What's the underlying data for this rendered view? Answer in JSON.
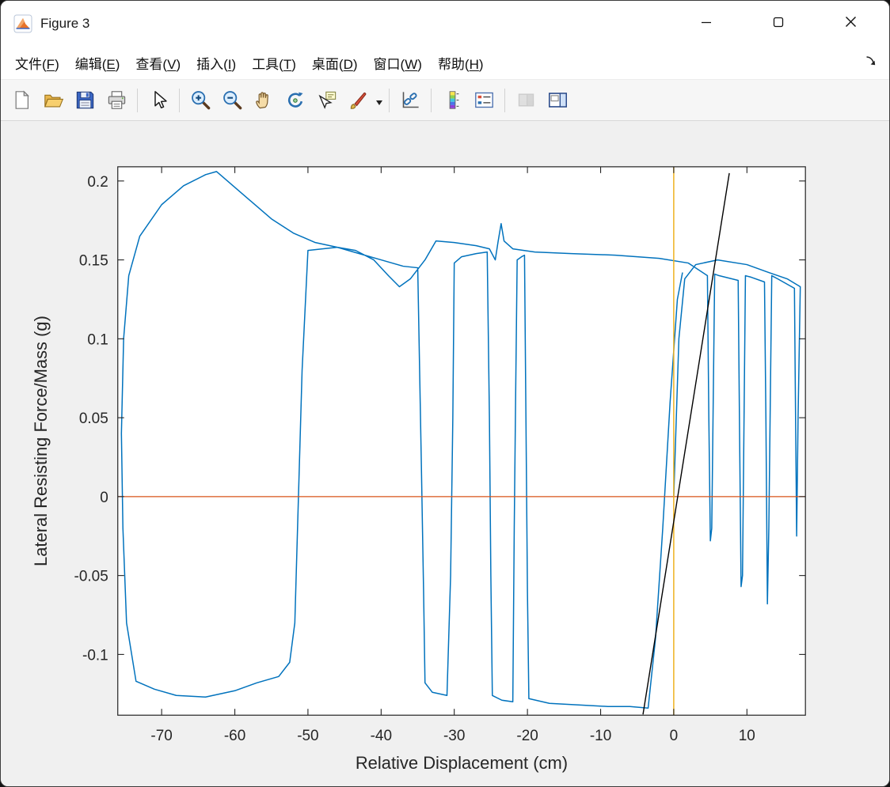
{
  "window": {
    "title": "Figure 3",
    "title_icon": "matlab-figure-icon",
    "control_icons": [
      "minimize-icon",
      "maximize-icon",
      "close-icon"
    ]
  },
  "menu": {
    "items": [
      {
        "text": "文件",
        "key": "F"
      },
      {
        "text": "编辑",
        "key": "E"
      },
      {
        "text": "查看",
        "key": "V"
      },
      {
        "text": "插入",
        "key": "I"
      },
      {
        "text": "工具",
        "key": "T"
      },
      {
        "text": "桌面",
        "key": "D"
      },
      {
        "text": "窗口",
        "key": "W"
      },
      {
        "text": "帮助",
        "key": "H"
      }
    ],
    "dock_icon": "dock-arrow-icon"
  },
  "toolbar": {
    "items": [
      {
        "name": "new-figure",
        "group": 1
      },
      {
        "name": "open-file",
        "group": 1
      },
      {
        "name": "save-figure",
        "group": 1
      },
      {
        "name": "print-figure",
        "group": 1
      },
      {
        "name": "edit-plot-pointer",
        "group": 2
      },
      {
        "name": "zoom-in",
        "group": 3
      },
      {
        "name": "zoom-out",
        "group": 3
      },
      {
        "name": "pan",
        "group": 3
      },
      {
        "name": "rotate-3d",
        "group": 3
      },
      {
        "name": "data-cursor",
        "group": 3
      },
      {
        "name": "brush-data",
        "group": 3,
        "has_dropdown": true
      },
      {
        "name": "link-plot",
        "group": 4
      },
      {
        "name": "insert-colorbar",
        "group": 5
      },
      {
        "name": "insert-legend",
        "group": 5
      },
      {
        "name": "hide-plot-tools",
        "group": 6,
        "disabled": true
      },
      {
        "name": "show-plot-tools",
        "group": 6
      }
    ]
  },
  "chart_data": {
    "type": "line",
    "title": "",
    "xlabel": "Relative Displacement (cm)",
    "ylabel": "Lateral Resisting Force/Mass (g)",
    "xlim": [
      -76,
      18
    ],
    "ylim": [
      -0.1385,
      0.209
    ],
    "xticks": [
      -70,
      -60,
      -50,
      -40,
      -30,
      -20,
      -10,
      0,
      10
    ],
    "yticks": [
      -0.1,
      -0.05,
      0,
      0.05,
      0.1,
      0.15,
      0.2
    ],
    "grid": false,
    "box": true,
    "colors": {
      "hysteresis": "#0072BD",
      "elastic": "#000000",
      "zero_force": "#D95319",
      "zero_disp": "#EDB120"
    },
    "series": [
      {
        "name": "hysteresis-loop",
        "color": "#0072BD",
        "width": 1.5,
        "points": [
          [
            0,
            0
          ],
          [
            0.7,
            0.1
          ],
          [
            1.5,
            0.138
          ],
          [
            3,
            0.147
          ],
          [
            6,
            0.15
          ],
          [
            10,
            0.147
          ],
          [
            13,
            0.142
          ],
          [
            15.5,
            0.138
          ],
          [
            17.3,
            0.133
          ],
          [
            17,
            0.05
          ],
          [
            16.8,
            -0.025
          ],
          [
            16.6,
            0.08
          ],
          [
            16.5,
            0.132
          ],
          [
            14.2,
            0.138
          ],
          [
            13.4,
            0.14
          ],
          [
            13,
            -0.02
          ],
          [
            12.8,
            -0.068
          ],
          [
            12.6,
            0.05
          ],
          [
            12.4,
            0.136
          ],
          [
            10.6,
            0.139
          ],
          [
            9.8,
            0.14
          ],
          [
            9.4,
            -0.05
          ],
          [
            9.2,
            -0.057
          ],
          [
            9,
            0.04
          ],
          [
            8.8,
            0.137
          ],
          [
            6.2,
            0.14
          ],
          [
            5.6,
            0.141
          ],
          [
            5.2,
            -0.02
          ],
          [
            5,
            -0.028
          ],
          [
            4.8,
            0.05
          ],
          [
            4.6,
            0.14
          ],
          [
            2,
            0.148
          ],
          [
            -2,
            0.151
          ],
          [
            -8,
            0.153
          ],
          [
            -14,
            0.154
          ],
          [
            -19,
            0.155
          ],
          [
            -22,
            0.157
          ],
          [
            -23.2,
            0.162
          ],
          [
            -23.6,
            0.173
          ],
          [
            -24,
            0.162
          ],
          [
            -24.4,
            0.15
          ],
          [
            -25.2,
            0.157
          ],
          [
            -27,
            0.159
          ],
          [
            -30,
            0.161
          ],
          [
            -32.5,
            0.162
          ],
          [
            -34,
            0.15
          ],
          [
            -36,
            0.138
          ],
          [
            -37.5,
            0.133
          ],
          [
            -39,
            0.14
          ],
          [
            -41,
            0.15
          ],
          [
            -43.5,
            0.156
          ],
          [
            -46,
            0.158
          ],
          [
            -48,
            0.157
          ],
          [
            -50,
            0.156
          ],
          [
            -50.8,
            0.08
          ],
          [
            -51.3,
            0
          ],
          [
            -51.8,
            -0.08
          ],
          [
            -52.5,
            -0.105
          ],
          [
            -54,
            -0.114
          ],
          [
            -57,
            -0.118
          ],
          [
            -60,
            -0.123
          ],
          [
            -64,
            -0.127
          ],
          [
            -68,
            -0.126
          ],
          [
            -71,
            -0.122
          ],
          [
            -73.5,
            -0.117
          ],
          [
            -74.8,
            -0.08
          ],
          [
            -75.3,
            -0.02
          ],
          [
            -75.5,
            0.04
          ],
          [
            -75.2,
            0.1
          ],
          [
            -74.5,
            0.14
          ],
          [
            -73,
            0.165
          ],
          [
            -70,
            0.185
          ],
          [
            -67,
            0.197
          ],
          [
            -64,
            0.204
          ],
          [
            -62.5,
            0.206
          ],
          [
            -61,
            0.2
          ],
          [
            -58,
            0.188
          ],
          [
            -55,
            0.176
          ],
          [
            -52,
            0.167
          ],
          [
            -49,
            0.161
          ],
          [
            -46,
            0.158
          ],
          [
            -43,
            0.154
          ],
          [
            -40,
            0.15
          ],
          [
            -37,
            0.146
          ],
          [
            -35,
            0.145
          ],
          [
            -34.5,
            0.02
          ],
          [
            -34.2,
            -0.06
          ],
          [
            -34,
            -0.118
          ],
          [
            -33,
            -0.124
          ],
          [
            -31,
            -0.126
          ],
          [
            -30.5,
            -0.05
          ],
          [
            -30.2,
            0.05
          ],
          [
            -30,
            0.148
          ],
          [
            -29,
            0.152
          ],
          [
            -27,
            0.154
          ],
          [
            -25.5,
            0.155
          ],
          [
            -25.2,
            0.05
          ],
          [
            -25,
            -0.05
          ],
          [
            -24.8,
            -0.126
          ],
          [
            -23.5,
            -0.129
          ],
          [
            -22,
            -0.13
          ],
          [
            -21.8,
            -0.02
          ],
          [
            -21.6,
            0.07
          ],
          [
            -21.4,
            0.15
          ],
          [
            -20.8,
            0.152
          ],
          [
            -20.4,
            0.153
          ],
          [
            -20.2,
            0.05
          ],
          [
            -20,
            -0.06
          ],
          [
            -19.8,
            -0.128
          ],
          [
            -17,
            -0.131
          ],
          [
            -13,
            -0.132
          ],
          [
            -9,
            -0.133
          ],
          [
            -6,
            -0.133
          ],
          [
            -3.5,
            -0.134
          ],
          [
            -2.5,
            -0.09
          ],
          [
            -1.5,
            -0.02
          ],
          [
            -0.5,
            0.06
          ],
          [
            0.5,
            0.125
          ],
          [
            1.2,
            0.142
          ]
        ]
      },
      {
        "name": "zero-force-line",
        "color": "#D95319",
        "width": 1.3,
        "points": [
          [
            -76,
            0
          ],
          [
            18,
            0
          ]
        ]
      },
      {
        "name": "zero-displacement-line",
        "color": "#EDB120",
        "width": 1.5,
        "points": [
          [
            0,
            -0.1385
          ],
          [
            0,
            0.209
          ]
        ]
      },
      {
        "name": "elastic-stiffness-line",
        "color": "#000000",
        "width": 1.4,
        "points": [
          [
            -4.2,
            -0.138
          ],
          [
            7.6,
            0.205
          ]
        ]
      }
    ]
  }
}
